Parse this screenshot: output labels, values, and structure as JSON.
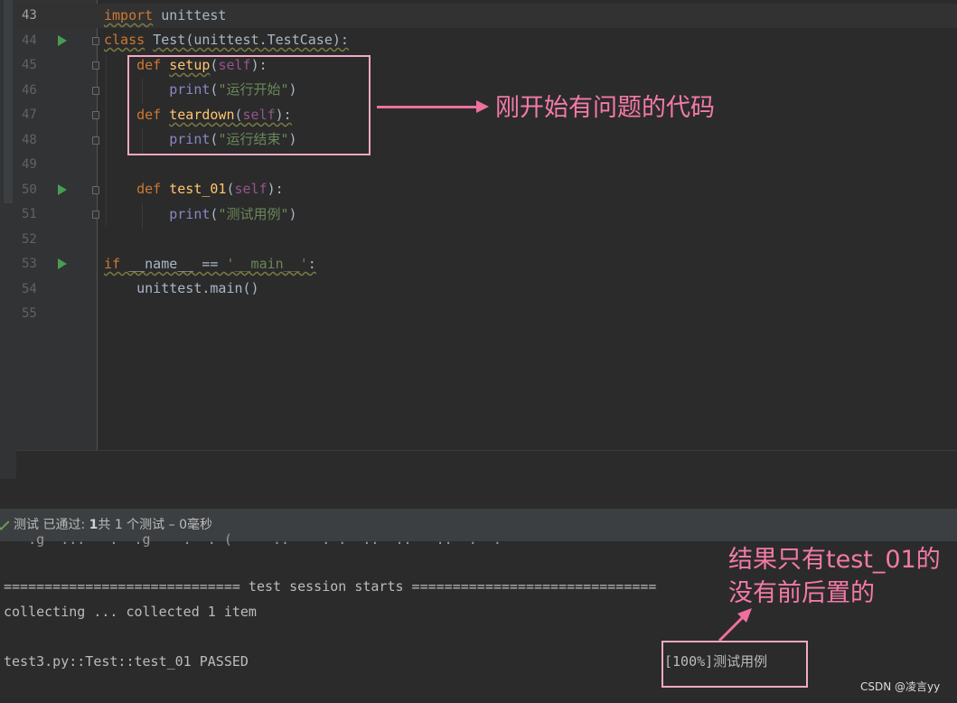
{
  "editor": {
    "lines": [
      {
        "num": "43",
        "run": false,
        "fold": false
      },
      {
        "num": "44",
        "run": true,
        "fold": true
      },
      {
        "num": "45",
        "run": false,
        "fold": true
      },
      {
        "num": "46",
        "run": false,
        "fold": true
      },
      {
        "num": "47",
        "run": false,
        "fold": true
      },
      {
        "num": "48",
        "run": false,
        "fold": true
      },
      {
        "num": "49",
        "run": false,
        "fold": false
      },
      {
        "num": "50",
        "run": true,
        "fold": true
      },
      {
        "num": "51",
        "run": false,
        "fold": true
      },
      {
        "num": "52",
        "run": false,
        "fold": false
      },
      {
        "num": "53",
        "run": true,
        "fold": false
      },
      {
        "num": "54",
        "run": false,
        "fold": false
      },
      {
        "num": "55",
        "run": false,
        "fold": false
      }
    ],
    "code": {
      "l43_kw": "import",
      "l43_rest": " unittest",
      "l44_kw": "class",
      "l44_name": "Test",
      "l44_rest": "(unittest.TestCase):",
      "l45_kw": "def",
      "l45_fn": "setup",
      "l45_p1": "(",
      "l45_self": "self",
      "l45_p2": "):",
      "l46_print": "print",
      "l46_p1": "(",
      "l46_str": "\"运行开始\"",
      "l46_p2": ")",
      "l47_kw": "def",
      "l47_fn": "teardown",
      "l47_p1": "(",
      "l47_self": "self",
      "l47_p2": "):",
      "l48_print": "print",
      "l48_p1": "(",
      "l48_str": "\"运行结束\"",
      "l48_p2": ")",
      "l50_kw": "def",
      "l50_fn": "test_01",
      "l50_p1": "(",
      "l50_self": "self",
      "l50_p2": "):",
      "l51_print": "print",
      "l51_p1": "(",
      "l51_str": "\"测试用例\"",
      "l51_p2": ")",
      "l53_kw": "if",
      "l53_name": " __name__ == ",
      "l53_str": "'__main__'",
      "l53_colon": ":",
      "l54": "unittest.main()"
    }
  },
  "annotations": {
    "top": "刚开始有问题的代码",
    "bottom_line1": "结果只有test_01的",
    "bottom_line2": "没有前后置的",
    "accent_color": "#f37aa7"
  },
  "status_bar": {
    "prefix": "测试 已通过: ",
    "passed": "1",
    "suffix": "共 1 个测试 – 0毫秒"
  },
  "console": {
    "clipped_line": "   .g  ...   .  .g    .  . (     ..    . .  ..  ..   ..  .  .",
    "session_line": "============================= test session starts ==============================",
    "collect_line": "collecting ... collected 1 item",
    "result_line": "test3.py::Test::test_01 PASSED",
    "output": "[100%]测试用例"
  },
  "watermark": "CSDN @凌言yy"
}
